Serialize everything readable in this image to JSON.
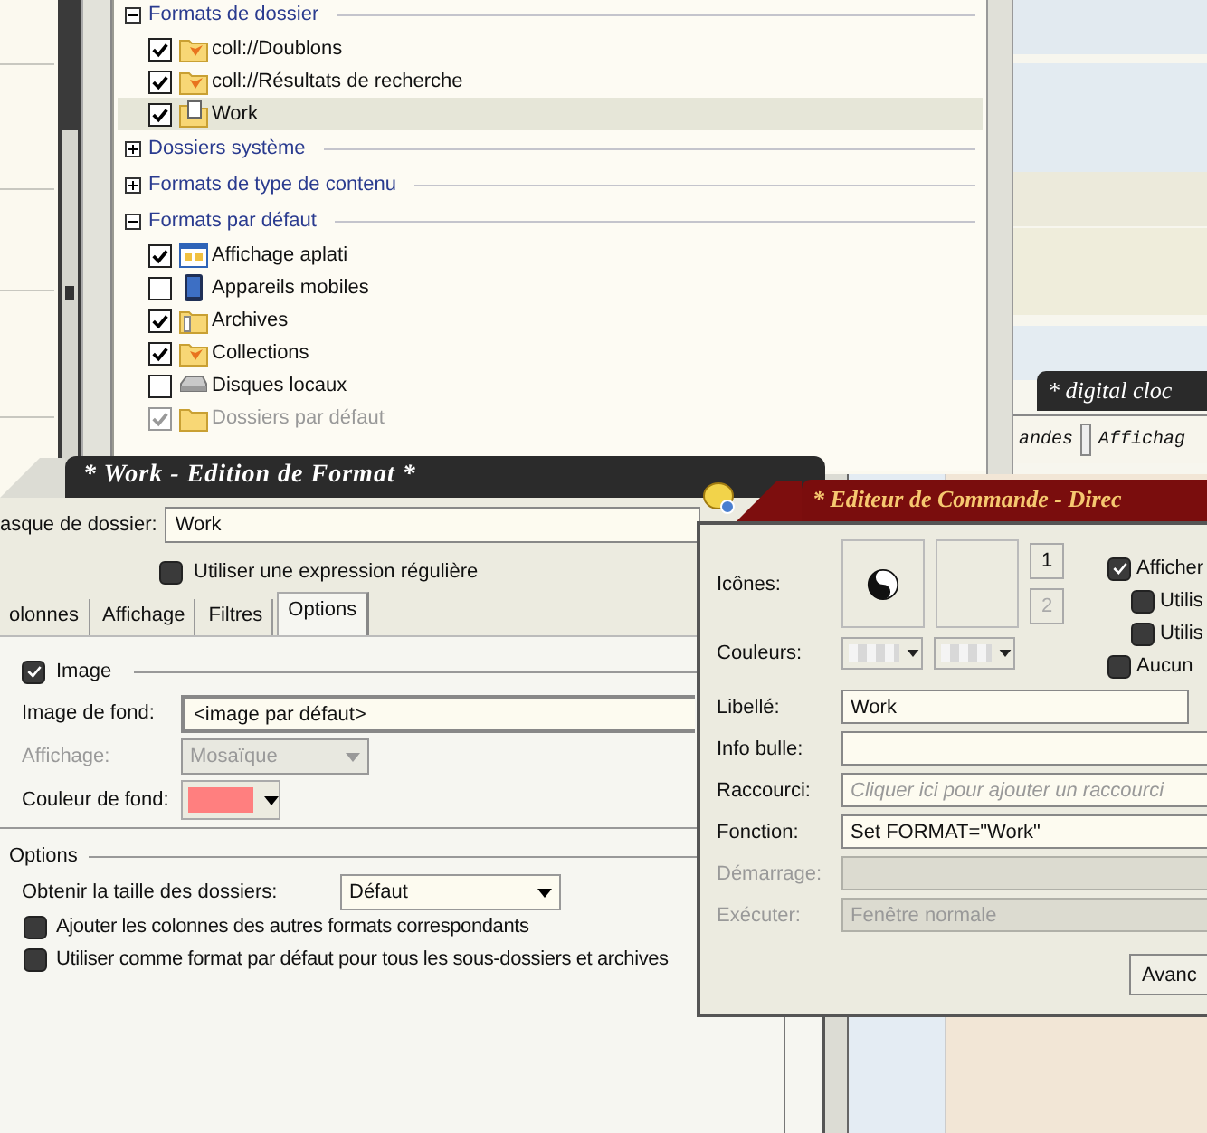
{
  "tree": {
    "groups": [
      {
        "label": "Formats de dossier",
        "expanded": true,
        "items": [
          {
            "label": "coll://Doublons",
            "checked": true,
            "disabled": false,
            "selected": false
          },
          {
            "label": "coll://Résultats de recherche",
            "checked": true,
            "disabled": false,
            "selected": false
          },
          {
            "label": "Work",
            "checked": true,
            "disabled": false,
            "selected": true
          }
        ]
      },
      {
        "label": "Dossiers système",
        "expanded": false
      },
      {
        "label": "Formats de type de contenu",
        "expanded": false
      },
      {
        "label": "Formats par défaut",
        "expanded": true,
        "items": [
          {
            "label": "Affichage aplati",
            "checked": true,
            "disabled": false,
            "selected": false
          },
          {
            "label": "Appareils mobiles",
            "checked": false,
            "disabled": false,
            "selected": false
          },
          {
            "label": "Archives",
            "checked": true,
            "disabled": false,
            "selected": false
          },
          {
            "label": "Collections",
            "checked": true,
            "disabled": false,
            "selected": false
          },
          {
            "label": "Disques locaux",
            "checked": false,
            "disabled": false,
            "selected": false
          },
          {
            "label": "Dossiers par défaut",
            "checked": true,
            "disabled": true,
            "selected": false
          }
        ]
      }
    ]
  },
  "background_window": {
    "title": "* digital cloc",
    "toolbar": [
      "andes",
      "Affichag"
    ]
  },
  "format_editor": {
    "title": "* Work - Edition de Format *",
    "mask": {
      "label": "asque de dossier:",
      "value": "Work"
    },
    "regex": {
      "label": "Utiliser une expression régulière",
      "checked": false
    },
    "tabs": [
      {
        "label": "olonnes",
        "selected": false
      },
      {
        "label": "Affichage",
        "selected": false
      },
      {
        "label": "Filtres",
        "selected": false
      },
      {
        "label": "Options",
        "selected": true
      }
    ],
    "image": {
      "label": "Image",
      "checked": true,
      "background_image": {
        "label": "Image de fond:",
        "value": "<image par défaut>"
      },
      "display": {
        "label": "Affichage:",
        "value": "Mosaïque",
        "disabled": true
      },
      "background_color": {
        "label": "Couleur de fond:",
        "color": "#ff7f7f"
      }
    },
    "options": {
      "label": "Options",
      "folder_size": {
        "label": "Obtenir la taille des dossiers:",
        "value": "Défaut"
      },
      "checkboxes": [
        {
          "label": "Ajouter les colonnes des autres formats correspondants",
          "checked": false
        },
        {
          "label": "Utiliser comme format par défaut pour tous les sous-dossiers et archives",
          "checked": false
        }
      ]
    }
  },
  "command_editor": {
    "title": "* Editeur de Commande - Direc",
    "icons_label": "Icônes:",
    "icon_buttons": [
      {
        "label": "1",
        "disabled": false
      },
      {
        "label": "2",
        "disabled": true
      }
    ],
    "colors_label": "Couleurs:",
    "options": [
      {
        "label": "Afficher",
        "checked": true,
        "children": [
          {
            "label": "Utilis",
            "checked": false
          },
          {
            "label": "Utilis",
            "checked": false
          }
        ]
      },
      {
        "label": "Aucun",
        "checked": false
      }
    ],
    "fields": [
      {
        "label": "Libellé:",
        "value": "Work",
        "disabled": false
      },
      {
        "label": "Info bulle:",
        "disabled": false
      },
      {
        "label": "Raccourci:",
        "placeholder": "Cliquer ici pour ajouter un raccourci",
        "disabled": false
      },
      {
        "label": "Fonction:",
        "value": "Set FORMAT=\"Work\"",
        "disabled": false
      },
      {
        "label": "Démarrage:",
        "disabled": true
      },
      {
        "label": "Exécuter:",
        "value": "Fenêtre normale",
        "disabled": true
      }
    ],
    "advanced_button": "Avanc"
  }
}
